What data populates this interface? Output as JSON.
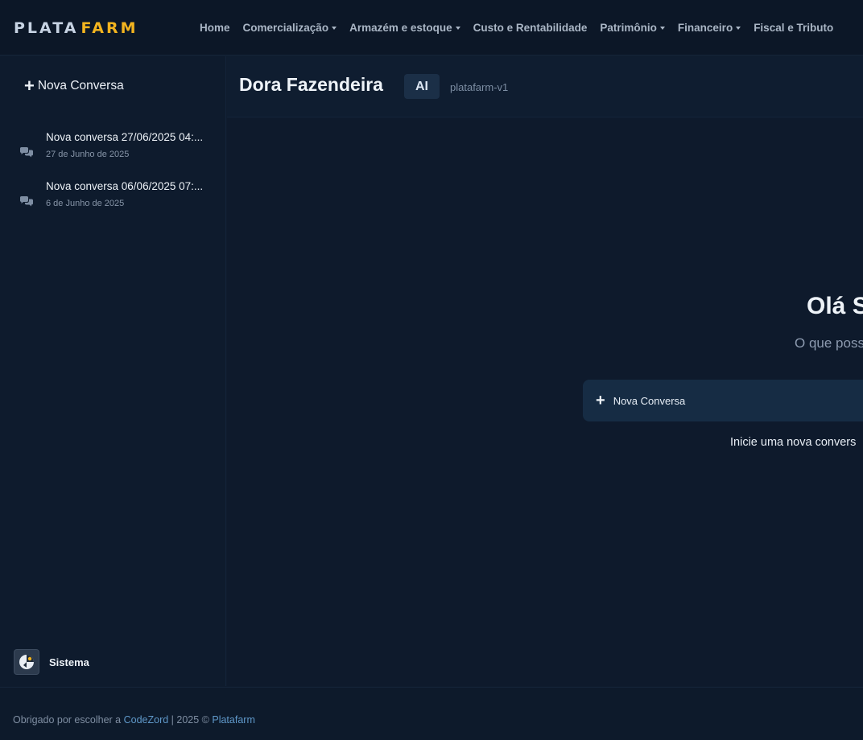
{
  "nav": {
    "logo_plata": "PLATA",
    "logo_farm": "FARM",
    "items": [
      {
        "label": "Home",
        "dropdown": false
      },
      {
        "label": "Comercialização",
        "dropdown": true
      },
      {
        "label": "Armazém e estoque",
        "dropdown": true
      },
      {
        "label": "Custo e Rentabilidade",
        "dropdown": false
      },
      {
        "label": "Patrimônio",
        "dropdown": true
      },
      {
        "label": "Financeiro",
        "dropdown": true
      },
      {
        "label": "Fiscal e Tributo",
        "dropdown": false
      }
    ]
  },
  "sidebar": {
    "new_conversation": "Nova Conversa",
    "conversations": [
      {
        "title": "Nova conversa 27/06/2025 04:...",
        "date": "27 de Junho de 2025",
        "icon": "chat-bubbles-icon"
      },
      {
        "title": "Nova conversa 06/06/2025 07:...",
        "date": "6 de Junho de 2025",
        "icon": "chat-bubbles-icon"
      }
    ],
    "system_label": "Sistema"
  },
  "chat": {
    "title": "Dora Fazendeira",
    "badge": "AI",
    "model": "platafarm-v1",
    "greeting": "Olá S",
    "subgreeting": "O que poss",
    "new_button": "Nova Conversa",
    "hint": "Inicie uma nova convers"
  },
  "footer": {
    "prefix": "Obrigado por escolher a ",
    "brand": "CodeZord",
    "middle": " | 2025 © ",
    "product": "Platafarm"
  },
  "colors": {
    "accent": "#f3b41f",
    "background": "#0f1c2e",
    "link": "#5f98c9"
  }
}
